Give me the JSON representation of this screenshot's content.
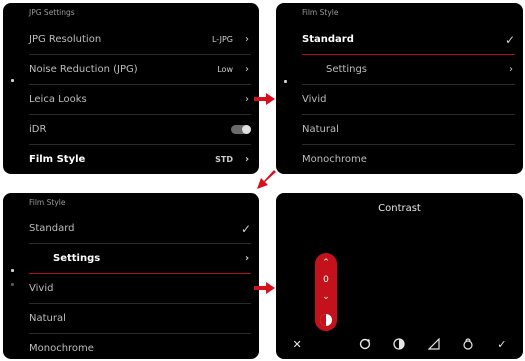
{
  "screen1": {
    "header": "JPG Settings",
    "rows": [
      {
        "label": "JPG Resolution",
        "value": "L-JPG"
      },
      {
        "label": "Noise Reduction (JPG)",
        "value": "Low"
      },
      {
        "label": "Leica Looks",
        "value": ""
      },
      {
        "label": "iDR",
        "value": ""
      },
      {
        "label": "Film Style",
        "value": "STD"
      }
    ]
  },
  "screen2": {
    "header": "Film Style",
    "rows": [
      {
        "label": "Standard"
      },
      {
        "label": "Settings"
      },
      {
        "label": "Vivid"
      },
      {
        "label": "Natural"
      },
      {
        "label": "Monochrome"
      }
    ]
  },
  "screen3": {
    "header": "Film Style",
    "rows": [
      {
        "label": "Standard"
      },
      {
        "label": "Settings"
      },
      {
        "label": "Vivid"
      },
      {
        "label": "Natural"
      },
      {
        "label": "Monochrome"
      }
    ]
  },
  "screen4": {
    "title": "Contrast",
    "slider_value": "0",
    "tools": [
      "close-icon",
      "contrast-icon",
      "saturation-icon",
      "tone-icon",
      "sharpness-icon",
      "filter-icon",
      "confirm-icon"
    ]
  },
  "colors": {
    "accent": "#c4121d",
    "arrow": "#d8101c"
  }
}
